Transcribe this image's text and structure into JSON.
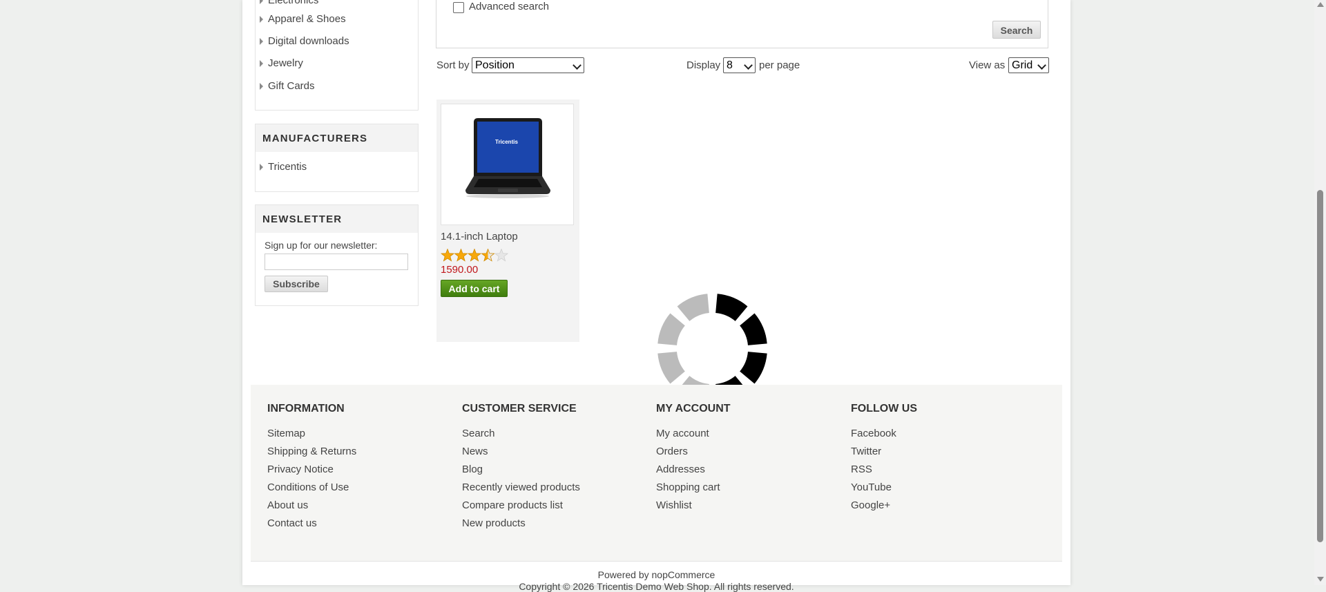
{
  "sidebar": {
    "categories": [
      "Electronics",
      "Apparel & Shoes",
      "Digital downloads",
      "Jewelry",
      "Gift Cards"
    ],
    "manufacturers_title": "MANUFACTURERS",
    "manufacturers": [
      "Tricentis"
    ],
    "newsletter": {
      "title": "NEWSLETTER",
      "prompt": "Sign up for our newsletter:",
      "email_value": "",
      "subscribe_label": "Subscribe"
    }
  },
  "search": {
    "advanced_label": "Advanced search",
    "advanced_checked": false,
    "search_button": "Search"
  },
  "toolbar": {
    "sort_label": "Sort by",
    "sort_value": "Position",
    "display_label": "Display",
    "display_value": "8",
    "per_page_label": "per page",
    "view_label": "View as",
    "view_value": "Grid"
  },
  "product": {
    "name": "14.1-inch Laptop",
    "image_brand": "Tricentis",
    "rating": 3.5,
    "rating_max": 5,
    "price": "1590.00",
    "add_to_cart": "Add to cart"
  },
  "footer": {
    "columns": [
      {
        "title": "INFORMATION",
        "links": [
          "Sitemap",
          "Shipping & Returns",
          "Privacy Notice",
          "Conditions of Use",
          "About us",
          "Contact us"
        ]
      },
      {
        "title": "CUSTOMER SERVICE",
        "links": [
          "Search",
          "News",
          "Blog",
          "Recently viewed products",
          "Compare products list",
          "New products"
        ]
      },
      {
        "title": "MY ACCOUNT",
        "links": [
          "My account",
          "Orders",
          "Addresses",
          "Shopping cart",
          "Wishlist"
        ]
      },
      {
        "title": "FOLLOW US",
        "links": [
          "Facebook",
          "Twitter",
          "RSS",
          "YouTube",
          "Google+"
        ]
      }
    ],
    "powered_by": "Powered by nopCommerce",
    "copyright": "Copyright © 2026 Tricentis Demo Web Shop. All rights reserved."
  },
  "colors": {
    "price": "#c0171c",
    "cart_green": "#4d8f16",
    "star": "#f7a80b",
    "spinner_dark": "#000000",
    "spinner_light": "#bbbbbb"
  }
}
